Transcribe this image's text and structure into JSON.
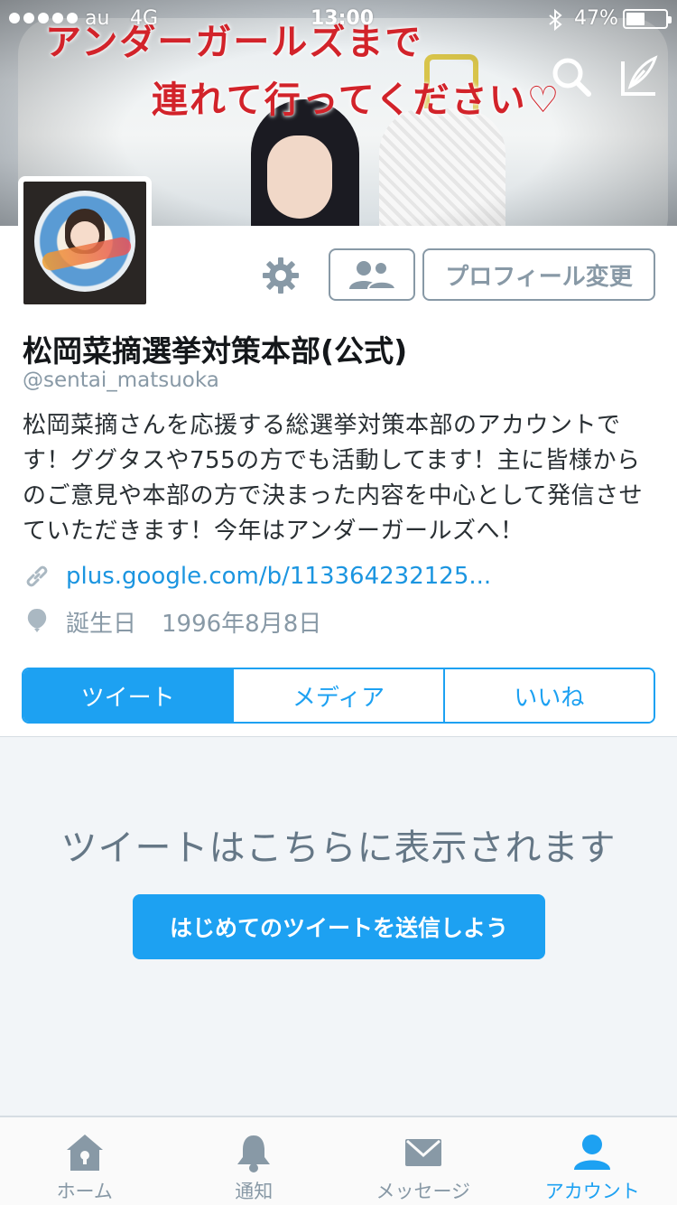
{
  "status_bar": {
    "carrier": "au",
    "network": "4G",
    "time": "13:00",
    "battery_percent": "47%",
    "battery_level": 0.47,
    "signal_dots": 5
  },
  "banner": {
    "caption_line1": "アンダーガールズまで",
    "caption_line2": "連れて行ってください♡"
  },
  "profile": {
    "name": "松岡菜摘選挙対策本部(公式)",
    "handle": "@sentai_matsuoka",
    "bio": "松岡菜摘さんを応援する総選挙対策本部のアカウントです！ググタスや755の方でも活動してます！主に皆様からのご意見や本部の方で決まった内容を中心として発信させていただきます！今年はアンダーガールズへ！",
    "link": "plus.google.com/b/113364232125...",
    "birthday_label": "誕生日",
    "birthday_value": "1996年8月8日",
    "edit_profile_label": "プロフィール変更"
  },
  "tabs": [
    {
      "label": "ツイート",
      "active": true
    },
    {
      "label": "メディア",
      "active": false
    },
    {
      "label": "いいね",
      "active": false
    }
  ],
  "feed": {
    "empty_text": "ツイートはこちらに表示されます",
    "cta_label": "はじめてのツイートを送信しよう"
  },
  "tabbar": [
    {
      "label": "ホーム",
      "icon": "home-icon"
    },
    {
      "label": "通知",
      "icon": "bell-icon"
    },
    {
      "label": "メッセージ",
      "icon": "envelope-icon"
    },
    {
      "label": "アカウント",
      "icon": "person-icon",
      "active": true
    }
  ],
  "colors": {
    "accent": "#1da1f2",
    "muted": "#8899a6",
    "banner_caption": "#d2232a",
    "feed_background": "#f2f5f8"
  }
}
